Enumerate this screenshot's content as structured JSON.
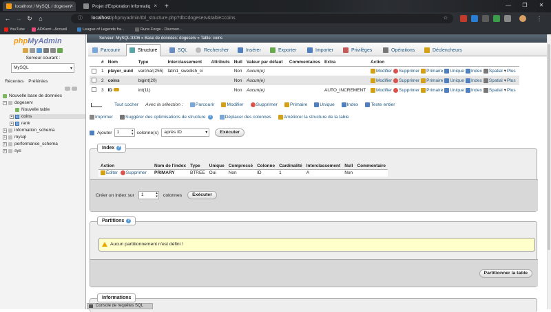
{
  "browser": {
    "tabs": [
      {
        "title": "localhost / MySQL / dogeserv"
      },
      {
        "title": "Projet d'Exploration Informatiq"
      }
    ],
    "new_tab": "+",
    "window_controls": [
      "—",
      "❐",
      "✕"
    ],
    "url_host": "localhost",
    "url_path": "/phpmyadmin/tbl_structure.php?db=dogeserv&table=coins",
    "bookmarks": [
      "YouTube",
      "ADKami - Accueil",
      "League of Legends fra...",
      "Rune Forge - Discover..."
    ]
  },
  "sidebar": {
    "logo_php": "php",
    "logo_myadmin": "MyAdmin",
    "server_label": "Serveur courant :",
    "server_value": "MySQL",
    "tabs": [
      "Récentes",
      "Préférées"
    ],
    "tree": [
      {
        "label": "Nouvelle base de données"
      },
      {
        "label": "dogeserv"
      },
      {
        "label": "Nouvelle table"
      },
      {
        "label": "coins"
      },
      {
        "label": "rank"
      },
      {
        "label": "information_schema"
      },
      {
        "label": "mysql"
      },
      {
        "label": "performance_schema"
      },
      {
        "label": "sys"
      }
    ]
  },
  "breadcrumb": {
    "server": "Serveur: MySQL:3306",
    "db": "Base de données: dogeserv",
    "table": "Table: coins",
    "sep": "»"
  },
  "menu": [
    "Parcourir",
    "Structure",
    "SQL",
    "Rechercher",
    "Insérer",
    "Exporter",
    "Importer",
    "Privilèges",
    "Opérations",
    "Déclencheurs"
  ],
  "structure": {
    "headers": [
      "#",
      "Nom",
      "Type",
      "Interclassement",
      "Attributs",
      "Null",
      "Valeur par défaut",
      "Commentaires",
      "Extra",
      "Action"
    ],
    "rows": [
      {
        "num": "1",
        "name": "player_uuid",
        "type": "varchar(255)",
        "collation": "latin1_swedish_ci",
        "attrs": "",
        "null": "Non",
        "default": "Aucun(e)",
        "comments": "",
        "extra": "",
        "primary": false
      },
      {
        "num": "2",
        "name": "coins",
        "type": "bigint(20)",
        "collation": "",
        "attrs": "",
        "null": "Non",
        "default": "Aucun(e)",
        "comments": "",
        "extra": "",
        "primary": false
      },
      {
        "num": "3",
        "name": "ID",
        "type": "int(11)",
        "collation": "",
        "attrs": "",
        "null": "Non",
        "default": "Aucun(e)",
        "comments": "",
        "extra": "AUTO_INCREMENT",
        "primary": true
      }
    ],
    "actions": [
      "Modifier",
      "Supprimer",
      "Primaire",
      "Unique",
      "Index",
      "Spatial",
      "Plus"
    ]
  },
  "with_selection": {
    "check_all": "Tout cocher",
    "label": "Avec la sélection :",
    "items": [
      "Parcourir",
      "Modifier",
      "Supprimer",
      "Primaire",
      "Unique",
      "Index",
      "Texte entier"
    ]
  },
  "tools": [
    "Imprimer",
    "Suggérer des optimisations de structure",
    "Déplacer des colonnes",
    "Améliorer la structure de la table"
  ],
  "add_column": {
    "label": "Ajouter",
    "count": "1",
    "unit": "colonne(s)",
    "position": "après ID",
    "go": "Exécuter"
  },
  "indexes": {
    "legend": "Index",
    "headers": [
      "Action",
      "Nom de l'index",
      "Type",
      "Unique",
      "Compressé",
      "Colonne",
      "Cardinalité",
      "Interclassement",
      "Null",
      "Commentaire"
    ],
    "rows": [
      {
        "edit": "Éditer",
        "drop": "Supprimer",
        "name": "PRIMARY",
        "type": "BTREE",
        "unique": "Oui",
        "packed": "Non",
        "column": "ID",
        "cardinality": "1",
        "collation": "A",
        "null": "Non",
        "comment": ""
      }
    ],
    "create_label": "Créer un index sur",
    "create_count": "1",
    "create_unit": "colonnes",
    "create_go": "Exécuter"
  },
  "partitions": {
    "legend": "Partitions",
    "notice": "Aucun partitionnement n'est défini !",
    "button": "Partitionner la table"
  },
  "information": {
    "legend": "Informations"
  },
  "console": "Console de requêtes SQL",
  "colors": {
    "accent_link": "#235a81",
    "warning": "#e8a800",
    "bar_dark": "#2d3035"
  }
}
